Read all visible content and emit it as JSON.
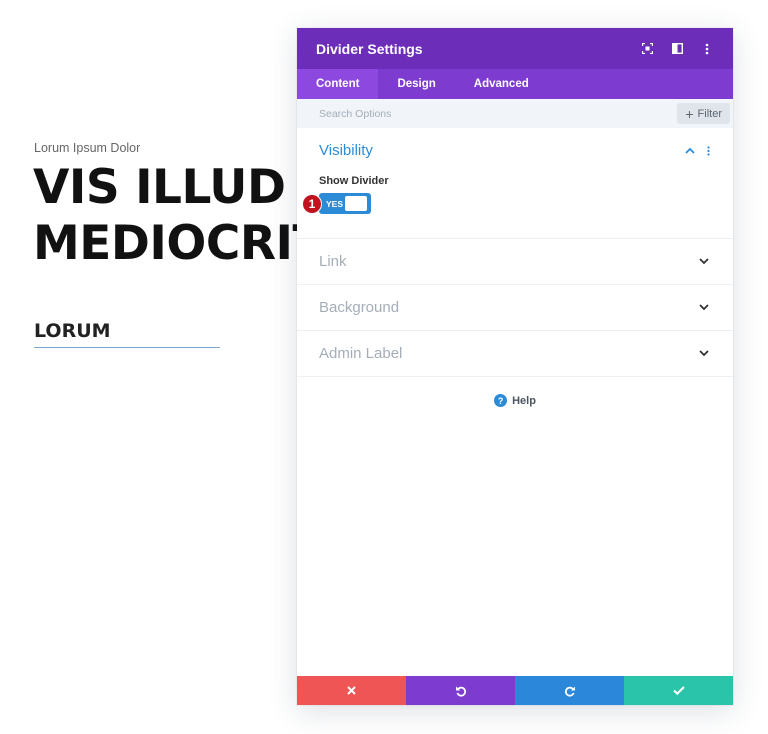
{
  "page": {
    "subtitle": "Lorum Ipsum Dolor",
    "heading_line1": "VIS ILLUD",
    "heading_line2": "MEDIOCRIT",
    "lorum": "LORUM"
  },
  "modal": {
    "title": "Divider Settings",
    "tabs": [
      {
        "label": "Content",
        "active": true
      },
      {
        "label": "Design",
        "active": false
      },
      {
        "label": "Advanced",
        "active": false
      }
    ],
    "search": {
      "placeholder": "Search Options",
      "filter_label": "Filter"
    },
    "sections": [
      {
        "title": "Visibility",
        "open": true
      },
      {
        "title": "Link",
        "open": false
      },
      {
        "title": "Background",
        "open": false
      },
      {
        "title": "Admin Label",
        "open": false
      }
    ],
    "visibility": {
      "field_label": "Show Divider",
      "toggle_text": "YES",
      "badge": "1"
    },
    "help_label": "Help"
  },
  "colors": {
    "header": "#6c2eb9",
    "tabs": "#7e3bd0",
    "accent_blue": "#2c8bd6",
    "cancel": "#ef5555",
    "undo": "#7e3bd0",
    "redo": "#2b87da",
    "save": "#29c4a9",
    "badge": "#c1121f"
  },
  "icons": {
    "header": [
      "focus-icon",
      "split-view-icon",
      "more-vertical-icon"
    ],
    "footer": [
      "close-icon",
      "undo-icon",
      "redo-icon",
      "check-icon"
    ]
  }
}
